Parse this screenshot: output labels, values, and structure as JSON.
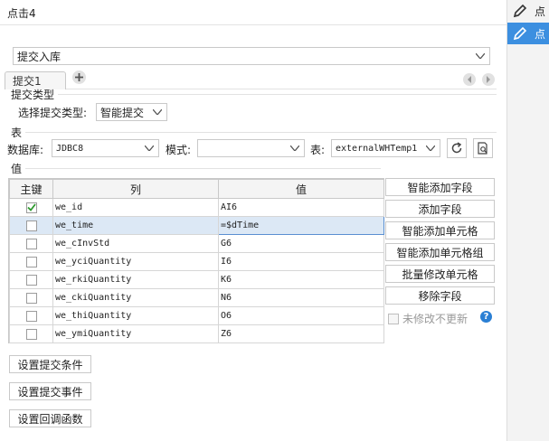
{
  "title": "点击4",
  "right_panel": {
    "items": [
      {
        "label": "点",
        "active": false
      },
      {
        "label": "点",
        "active": true
      }
    ]
  },
  "commit_type_select": "提交入库",
  "tab_label": "提交1",
  "sections": {
    "commit_type": "提交类型",
    "table": "表",
    "value": "值"
  },
  "select_commit_type_label": "选择提交类型:",
  "commit_type_value": "智能提交",
  "db_label": "数据库:",
  "db_value": "JDBC8",
  "mode_label": "模式:",
  "mode_value": "",
  "table_label": "表:",
  "table_value": "externalWHTemp1",
  "grid": {
    "headers": [
      "主键",
      "列",
      "值"
    ],
    "rows": [
      {
        "key": true,
        "col": "we_id",
        "val": "AI6"
      },
      {
        "key": false,
        "col": "we_time",
        "val": "=$dTime"
      },
      {
        "key": false,
        "col": "we_cInvStd",
        "val": "G6"
      },
      {
        "key": false,
        "col": "we_yciQuantity",
        "val": "I6"
      },
      {
        "key": false,
        "col": "we_rkiQuantity",
        "val": "K6"
      },
      {
        "key": false,
        "col": "we_ckiQuantity",
        "val": "N6"
      },
      {
        "key": false,
        "col": "we_thiQuantity",
        "val": "O6"
      },
      {
        "key": false,
        "col": "we_ymiQuantity",
        "val": "Z6"
      }
    ]
  },
  "side_buttons": [
    "智能添加字段",
    "添加字段",
    "智能添加单元格",
    "智能添加单元格组",
    "批量修改单元格",
    "移除字段"
  ],
  "unchanged_no_update": "未修改不更新",
  "bottom_buttons": [
    "设置提交条件",
    "设置提交事件",
    "设置回调函数"
  ],
  "colors": {
    "accent": "#3c8fe0",
    "check": "#2e9a2e",
    "help": "#2a7fd4"
  }
}
